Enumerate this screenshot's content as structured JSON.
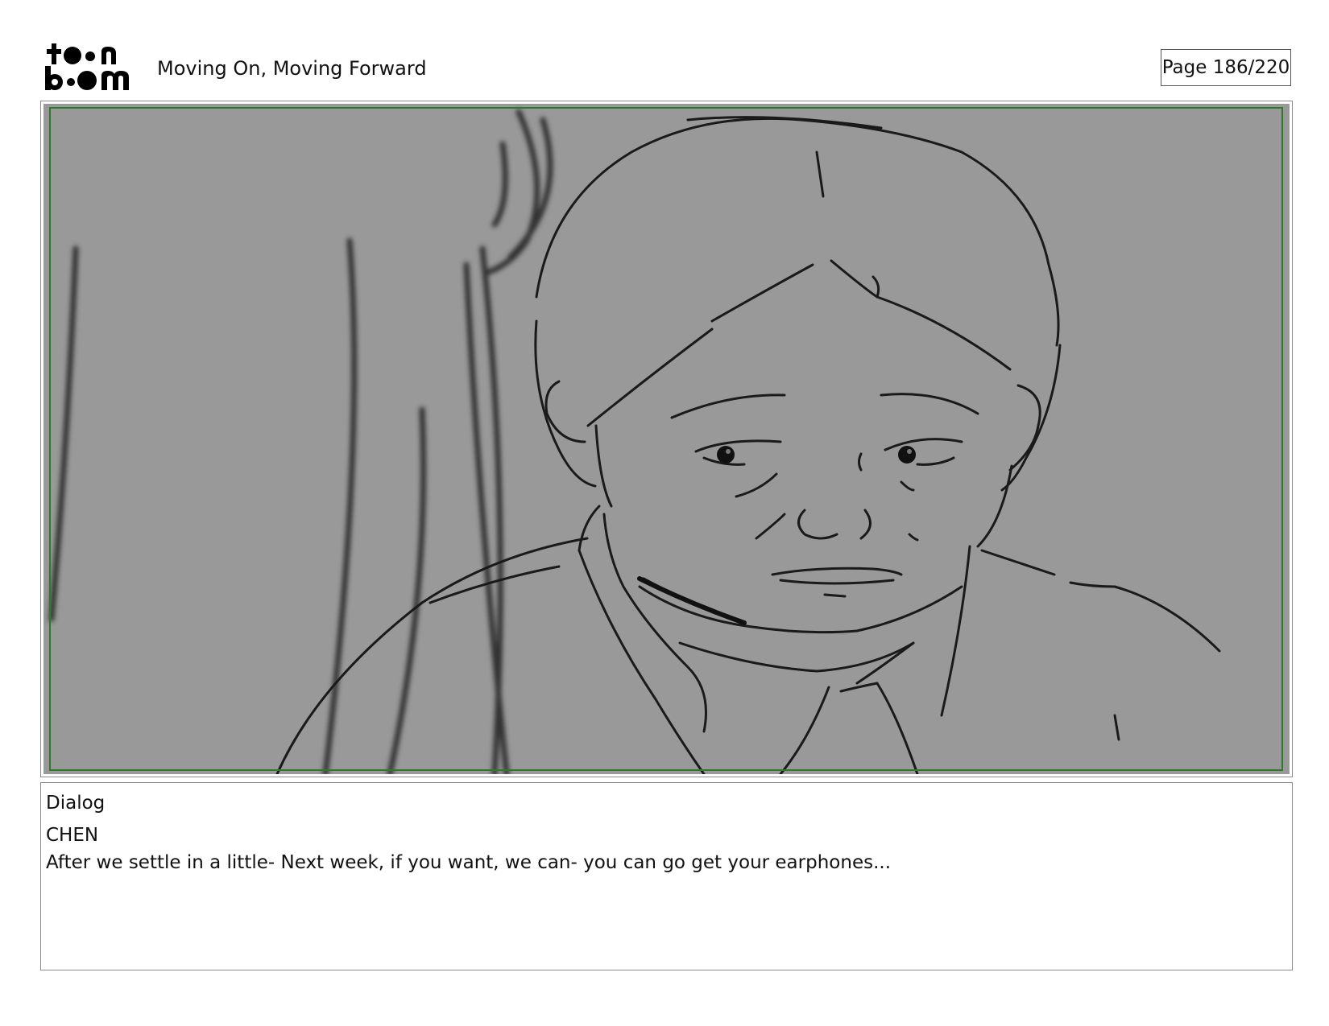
{
  "header": {
    "logo_alt": "toon boom",
    "project_title": "Moving On, Moving Forward",
    "page_counter": "Page 186/220"
  },
  "panel": {
    "background_color": "#999999",
    "safe_area_color": "#2d7a2d",
    "sketch_color": "#1a1a1a"
  },
  "dialog": {
    "heading": "Dialog",
    "speaker": "CHEN",
    "line": "After we settle in a little- Next week, if you want, we can- you can go get your earphones..."
  }
}
